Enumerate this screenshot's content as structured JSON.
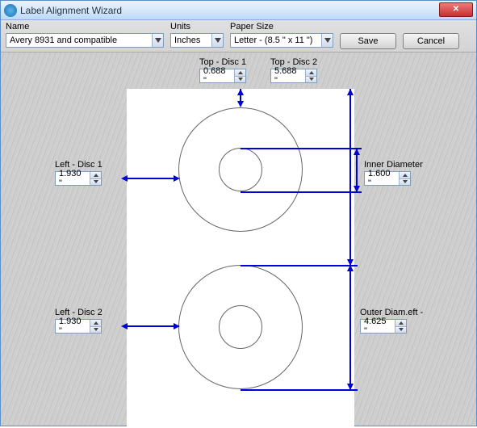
{
  "window": {
    "title": "Label Alignment Wizard"
  },
  "toolbar": {
    "name_label": "Name",
    "name_value": "Avery 8931 and compatible",
    "units_label": "Units",
    "units_value": "Inches",
    "paper_label": "Paper Size",
    "paper_value": "Letter - (8.5 \" x 11 \")",
    "save": "Save",
    "cancel": "Cancel"
  },
  "measures": {
    "top_disc1_label": "Top - Disc 1",
    "top_disc1_value": "0.688 \"",
    "top_disc2_label": "Top - Disc 2",
    "top_disc2_value": "5.688 \"",
    "left_disc1_label": "Left - Disc 1",
    "left_disc1_value": "1.930 \"",
    "left_disc2_label": "Left - Disc 2",
    "left_disc2_value": "1.930 \"",
    "inner_diam_label": "Inner Diameter",
    "inner_diam_value": "1.600 \"",
    "outer_diam_label": "Outer Diam.eft -",
    "outer_diam_value": "4.625 \""
  }
}
